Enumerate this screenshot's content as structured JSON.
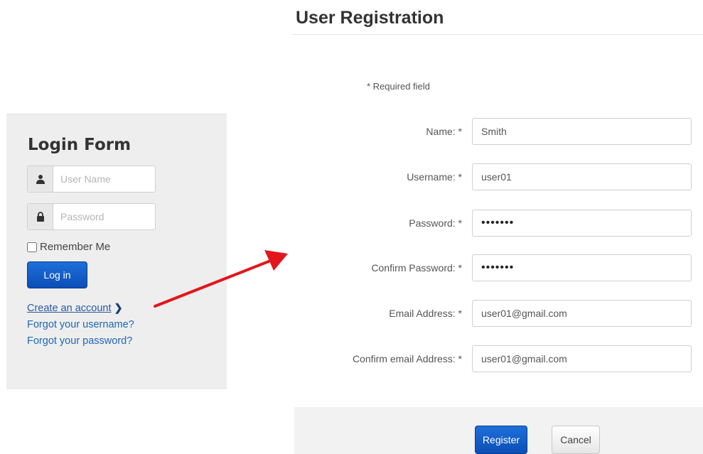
{
  "login_form": {
    "title": "Login Form",
    "username_placeholder": "User Name",
    "password_placeholder": "Password",
    "remember_label": "Remember Me",
    "login_button": "Log in",
    "links": {
      "create_account": "Create an account",
      "forgot_username": "Forgot your username?",
      "forgot_password": "Forgot your password?"
    },
    "icons": {
      "user": "user-icon",
      "lock": "lock-icon",
      "chevron": "chevron-right-icon"
    }
  },
  "registration": {
    "title": "User Registration",
    "required_note": "* Required field",
    "fields": {
      "name": {
        "label": "Name: *",
        "value": "Smith"
      },
      "username": {
        "label": "Username: *",
        "value": "user01"
      },
      "password": {
        "label": "Password: *",
        "value": "secret1"
      },
      "confirm_password": {
        "label": "Confirm Password: *",
        "value": "secret1"
      },
      "email": {
        "label": "Email Address: *",
        "value": "user01@gmail.com"
      },
      "confirm_email": {
        "label": "Confirm email Address: *",
        "value": "user01@gmail.com"
      }
    },
    "register_button": "Register",
    "cancel_button": "Cancel"
  },
  "annotation": {
    "arrow_color": "#e3161b"
  },
  "colors": {
    "primary_button": "#1560cc",
    "link": "#1f66b5",
    "panel_bg": "#eeeeee"
  }
}
